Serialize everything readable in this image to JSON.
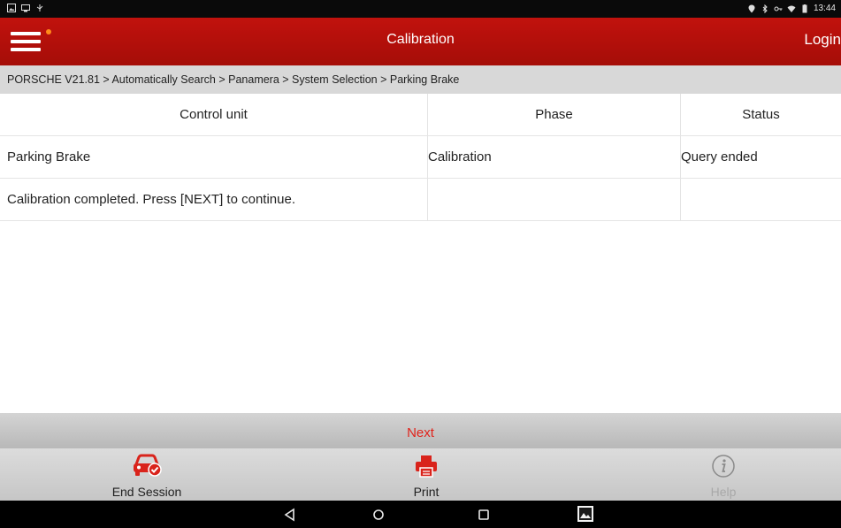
{
  "status_bar": {
    "time": "13:44",
    "left_icons": [
      "image-notification-icon",
      "cast-icon",
      "usb-icon"
    ],
    "right_icons": [
      "location-icon",
      "bluetooth-icon",
      "vpn-key-icon",
      "wifi-icon",
      "battery-icon"
    ]
  },
  "header": {
    "title": "Calibration",
    "login_label": "Login",
    "menu_icon": "hamburger-menu-icon",
    "colors": {
      "bar": "#b5100b",
      "notification_dot": "#ff8a1a"
    }
  },
  "breadcrumb": {
    "text": "PORSCHE V21.81 > Automatically Search > Panamera > System Selection > Parking Brake"
  },
  "table": {
    "columns": [
      "Control unit",
      "Phase",
      "Status"
    ],
    "rows": [
      [
        "Parking Brake",
        "Calibration",
        "Query ended"
      ],
      [
        "Calibration completed. Press [NEXT] to continue.",
        "",
        ""
      ]
    ]
  },
  "next_button": {
    "label": "Next",
    "color": "#e0231b"
  },
  "toolbar": {
    "end_session": {
      "label": "End Session",
      "icon": "car-check-icon"
    },
    "print": {
      "label": "Print",
      "icon": "printer-icon"
    },
    "help": {
      "label": "Help",
      "icon": "info-icon",
      "enabled": false
    }
  },
  "nav_bar": {
    "buttons": [
      "back-icon",
      "home-icon",
      "recents-icon",
      "gallery-icon"
    ]
  }
}
